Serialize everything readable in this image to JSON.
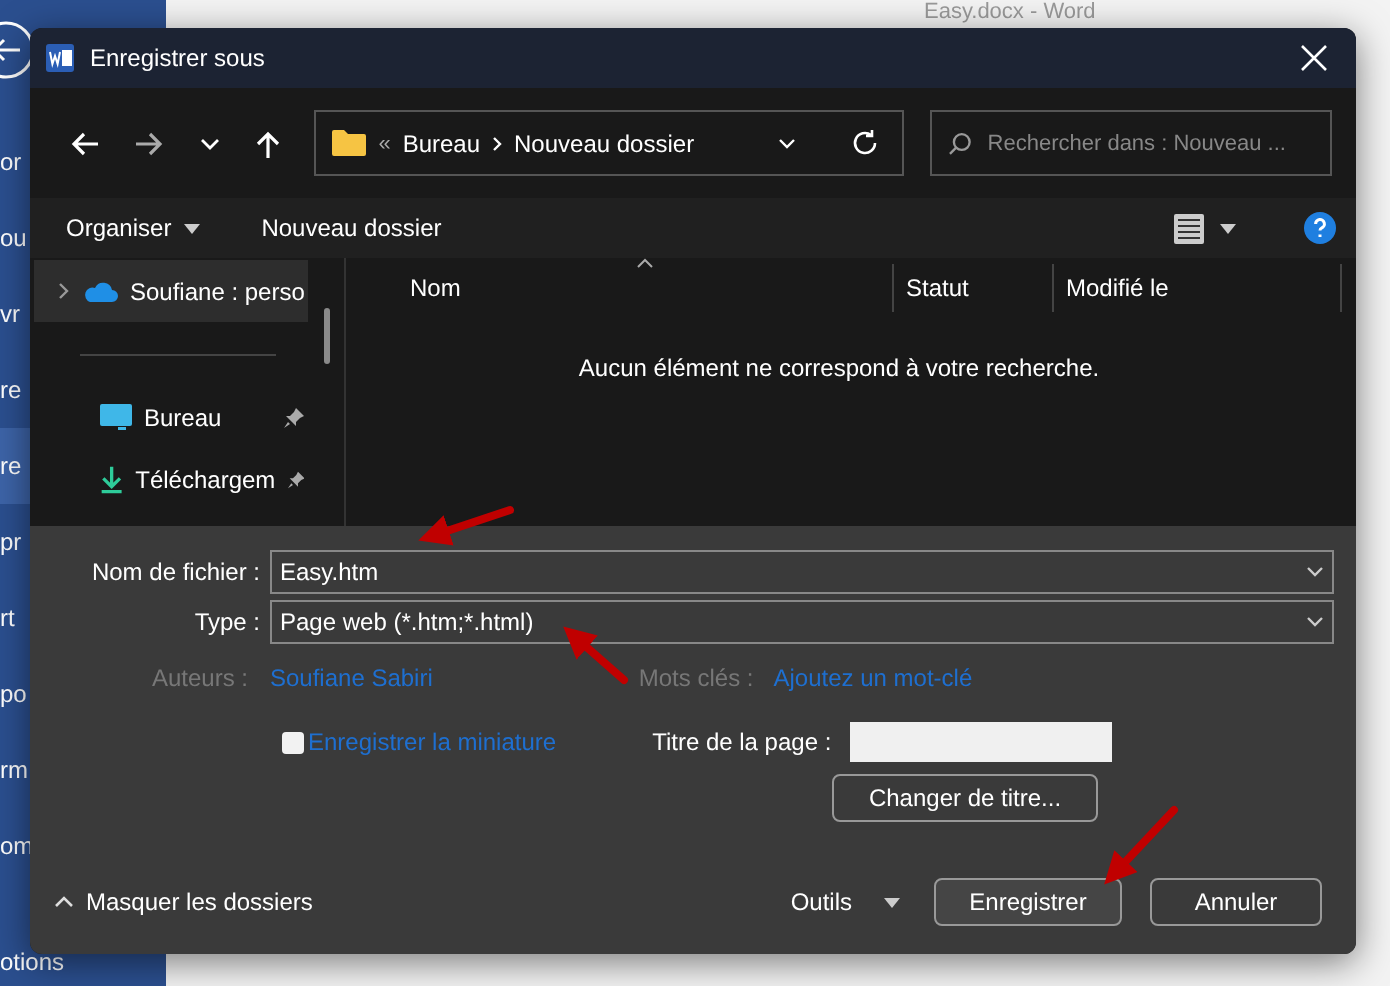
{
  "background": {
    "window_title": "Easy.docx - Word",
    "sidebar_items": [
      {
        "label": "or",
        "selected": false
      },
      {
        "label": "ou",
        "selected": false
      },
      {
        "label": "vr",
        "selected": false
      },
      {
        "label": "re",
        "selected": false
      },
      {
        "label": "re",
        "selected": true
      },
      {
        "label": "pr",
        "selected": false
      },
      {
        "label": "rt",
        "selected": false
      },
      {
        "label": "po",
        "selected": false
      },
      {
        "label": "rm",
        "selected": false
      },
      {
        "label": "om",
        "selected": false
      },
      {
        "label": "otions",
        "selected": false
      }
    ]
  },
  "dialog": {
    "title": "Enregistrer sous",
    "path": {
      "prefix": "«",
      "segments": [
        "Bureau",
        "Nouveau dossier"
      ]
    },
    "search": {
      "placeholder": "Rechercher dans : Nouveau ..."
    },
    "toolbar": {
      "organize": "Organiser",
      "new_folder": "Nouveau dossier"
    },
    "nav_pane": [
      {
        "label": "Soufiane : perso",
        "kind": "cloud",
        "selected": true
      },
      {
        "label": "Bureau",
        "kind": "desktop",
        "selected": false
      },
      {
        "label": "Téléchargem",
        "kind": "download",
        "selected": false
      }
    ],
    "columns": [
      "Nom",
      "Statut",
      "Modifié le"
    ],
    "empty_message": "Aucun élément ne correspond à votre recherche.",
    "form": {
      "filename_label": "Nom de fichier :",
      "filename": "Easy.htm",
      "type_label": "Type :",
      "type": "Page web (*.htm;*.html)",
      "authors_label": "Auteurs :",
      "authors": "Soufiane Sabiri",
      "keywords_label": "Mots clés :",
      "keywords": "Ajoutez un mot-clé",
      "thumbnail": {
        "label": "Enregistrer la miniature",
        "checked": false
      },
      "page_title_label": "Titre de la page :",
      "change_title": "Changer de titre..."
    },
    "footer": {
      "hide_folders": "Masquer les dossiers",
      "tools": "Outils",
      "save": "Enregistrer",
      "cancel": "Annuler"
    }
  }
}
